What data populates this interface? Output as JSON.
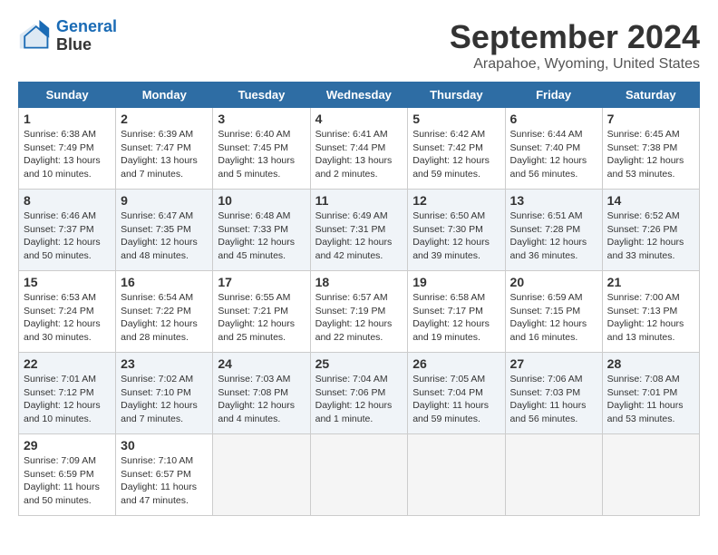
{
  "logo": {
    "line1": "General",
    "line2": "Blue"
  },
  "title": "September 2024",
  "location": "Arapahoe, Wyoming, United States",
  "headers": [
    "Sunday",
    "Monday",
    "Tuesday",
    "Wednesday",
    "Thursday",
    "Friday",
    "Saturday"
  ],
  "weeks": [
    [
      {
        "day": "1",
        "sunrise": "6:38 AM",
        "sunset": "7:49 PM",
        "daylight": "13 hours and 10 minutes."
      },
      {
        "day": "2",
        "sunrise": "6:39 AM",
        "sunset": "7:47 PM",
        "daylight": "13 hours and 7 minutes."
      },
      {
        "day": "3",
        "sunrise": "6:40 AM",
        "sunset": "7:45 PM",
        "daylight": "13 hours and 5 minutes."
      },
      {
        "day": "4",
        "sunrise": "6:41 AM",
        "sunset": "7:44 PM",
        "daylight": "13 hours and 2 minutes."
      },
      {
        "day": "5",
        "sunrise": "6:42 AM",
        "sunset": "7:42 PM",
        "daylight": "12 hours and 59 minutes."
      },
      {
        "day": "6",
        "sunrise": "6:44 AM",
        "sunset": "7:40 PM",
        "daylight": "12 hours and 56 minutes."
      },
      {
        "day": "7",
        "sunrise": "6:45 AM",
        "sunset": "7:38 PM",
        "daylight": "12 hours and 53 minutes."
      }
    ],
    [
      {
        "day": "8",
        "sunrise": "6:46 AM",
        "sunset": "7:37 PM",
        "daylight": "12 hours and 50 minutes."
      },
      {
        "day": "9",
        "sunrise": "6:47 AM",
        "sunset": "7:35 PM",
        "daylight": "12 hours and 48 minutes."
      },
      {
        "day": "10",
        "sunrise": "6:48 AM",
        "sunset": "7:33 PM",
        "daylight": "12 hours and 45 minutes."
      },
      {
        "day": "11",
        "sunrise": "6:49 AM",
        "sunset": "7:31 PM",
        "daylight": "12 hours and 42 minutes."
      },
      {
        "day": "12",
        "sunrise": "6:50 AM",
        "sunset": "7:30 PM",
        "daylight": "12 hours and 39 minutes."
      },
      {
        "day": "13",
        "sunrise": "6:51 AM",
        "sunset": "7:28 PM",
        "daylight": "12 hours and 36 minutes."
      },
      {
        "day": "14",
        "sunrise": "6:52 AM",
        "sunset": "7:26 PM",
        "daylight": "12 hours and 33 minutes."
      }
    ],
    [
      {
        "day": "15",
        "sunrise": "6:53 AM",
        "sunset": "7:24 PM",
        "daylight": "12 hours and 30 minutes."
      },
      {
        "day": "16",
        "sunrise": "6:54 AM",
        "sunset": "7:22 PM",
        "daylight": "12 hours and 28 minutes."
      },
      {
        "day": "17",
        "sunrise": "6:55 AM",
        "sunset": "7:21 PM",
        "daylight": "12 hours and 25 minutes."
      },
      {
        "day": "18",
        "sunrise": "6:57 AM",
        "sunset": "7:19 PM",
        "daylight": "12 hours and 22 minutes."
      },
      {
        "day": "19",
        "sunrise": "6:58 AM",
        "sunset": "7:17 PM",
        "daylight": "12 hours and 19 minutes."
      },
      {
        "day": "20",
        "sunrise": "6:59 AM",
        "sunset": "7:15 PM",
        "daylight": "12 hours and 16 minutes."
      },
      {
        "day": "21",
        "sunrise": "7:00 AM",
        "sunset": "7:13 PM",
        "daylight": "12 hours and 13 minutes."
      }
    ],
    [
      {
        "day": "22",
        "sunrise": "7:01 AM",
        "sunset": "7:12 PM",
        "daylight": "12 hours and 10 minutes."
      },
      {
        "day": "23",
        "sunrise": "7:02 AM",
        "sunset": "7:10 PM",
        "daylight": "12 hours and 7 minutes."
      },
      {
        "day": "24",
        "sunrise": "7:03 AM",
        "sunset": "7:08 PM",
        "daylight": "12 hours and 4 minutes."
      },
      {
        "day": "25",
        "sunrise": "7:04 AM",
        "sunset": "7:06 PM",
        "daylight": "12 hours and 1 minute."
      },
      {
        "day": "26",
        "sunrise": "7:05 AM",
        "sunset": "7:04 PM",
        "daylight": "11 hours and 59 minutes."
      },
      {
        "day": "27",
        "sunrise": "7:06 AM",
        "sunset": "7:03 PM",
        "daylight": "11 hours and 56 minutes."
      },
      {
        "day": "28",
        "sunrise": "7:08 AM",
        "sunset": "7:01 PM",
        "daylight": "11 hours and 53 minutes."
      }
    ],
    [
      {
        "day": "29",
        "sunrise": "7:09 AM",
        "sunset": "6:59 PM",
        "daylight": "11 hours and 50 minutes."
      },
      {
        "day": "30",
        "sunrise": "7:10 AM",
        "sunset": "6:57 PM",
        "daylight": "11 hours and 47 minutes."
      },
      null,
      null,
      null,
      null,
      null
    ]
  ]
}
